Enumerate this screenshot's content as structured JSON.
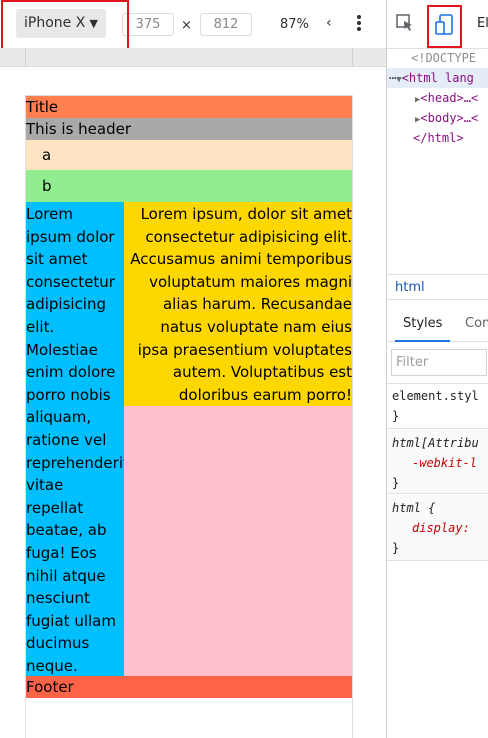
{
  "device_toolbar": {
    "device": "iPhone X",
    "width": "375",
    "times": "×",
    "height": "812",
    "zoom": "87%",
    "throttle_glyph": "‹"
  },
  "page": {
    "title": "Title",
    "header": "This is header",
    "nav": [
      "a",
      "b"
    ],
    "sidebar_lines": [
      "Lorem",
      "ipsum dolor",
      "sit amet",
      "consectetur",
      "adipisicing",
      "elit.",
      "Molestiae",
      "enim dolore",
      "porro nobis",
      "aliquam,",
      "ratione vel",
      "reprehenderit",
      "vitae",
      "repellat",
      "beatae, ab",
      "fuga! Eos",
      "nihil atque",
      "nesciunt",
      "fugiat ullam",
      "ducimus",
      "neque."
    ],
    "article_lines": [
      "Lorem ipsum, dolor sit amet",
      "consectetur adipisicing elit.",
      "Accusamus animi temporibus",
      "voluptatum maiores magni",
      "alias harum. Recusandae",
      "natus voluptate nam eius",
      "ipsa praesentium voluptates",
      "autem. Voluptatibus est",
      "doloribus earum porro!"
    ],
    "footer": "Footer"
  },
  "devtools": {
    "tab_elements": "El",
    "dom": {
      "doctype": "<!DOCTYPE",
      "html_tag": "<html lang",
      "head": "<head>…<",
      "body": "<body>…<",
      "html_close": "</html>"
    },
    "breadcrumb": "html",
    "styles_tabs": [
      "Styles",
      "Con"
    ],
    "filter_placeholder": "Filter",
    "rules": {
      "element_style": "element.styl",
      "brace_close": "}",
      "attr_selector": "html[Attribu",
      "webkit_prop": "-webkit-l",
      "html_selector": "html {",
      "display_prop": "display:"
    }
  },
  "colors": {
    "title": "#ff7f50",
    "header": "#a9a9a9",
    "nav_a": "#ffe4c4",
    "nav_b": "#90ee90",
    "sidebar": "#00bfff",
    "article": "#ffd700",
    "filler": "#ffc0cb",
    "footer": "#ff6347",
    "highlight": "#e2141b"
  }
}
